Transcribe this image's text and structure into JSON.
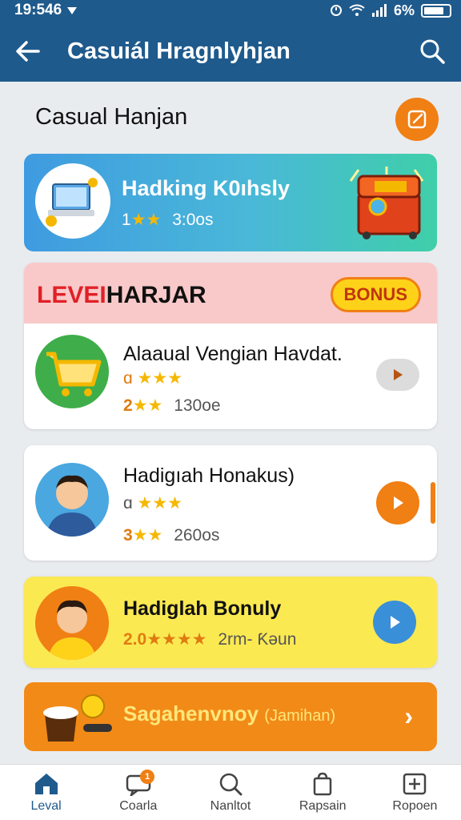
{
  "status": {
    "time": "19:546",
    "battery": "6%"
  },
  "appbar": {
    "title": "Casuiál Hragnlyhjan"
  },
  "section": {
    "heading": "Casual Hanjan"
  },
  "banner": {
    "title": "Hadking K0ıhsly",
    "rating": "1",
    "count": "3:0os"
  },
  "level_card": {
    "title_red": "LEVEI",
    "title_dark": "HARJAR",
    "bonus_label": "BONUS",
    "item": {
      "title": "Alaaual Vengian Havdat.",
      "meta1_prefix": "ɑ",
      "rating": "2",
      "count": "130oe"
    }
  },
  "list": [
    {
      "title": "Hadigıah Honakus)",
      "meta1_prefix": "ɑ",
      "rating": "3",
      "count": "260os"
    },
    {
      "title": "Hadiglah Bonuly",
      "rating": "2.0",
      "count": "2rm- Ƙəun"
    }
  ],
  "promo": {
    "title": "Sagahenvnoy",
    "suffix": "(Jamihan)"
  },
  "nav": [
    {
      "label": "Leval",
      "icon": "home-icon"
    },
    {
      "label": "Coarla",
      "icon": "chat-icon",
      "badge": "1"
    },
    {
      "label": "Nanltot",
      "icon": "search-icon"
    },
    {
      "label": "Rapsain",
      "icon": "bag-icon"
    },
    {
      "label": "Ropoen",
      "icon": "plus-box-icon"
    }
  ],
  "colors": {
    "primary": "#1f5a8c",
    "accent": "#f07f14",
    "star": "#f5b800",
    "blue_play": "#3a8fd9"
  }
}
